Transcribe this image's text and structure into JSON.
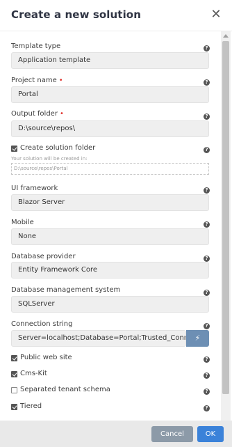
{
  "dialog": {
    "title": "Create a new solution",
    "close_glyph": "✕"
  },
  "help_glyph": "?",
  "template_type": {
    "label": "Template type",
    "value": "Application template"
  },
  "project_name": {
    "label": "Project name",
    "value": "Portal",
    "required_mark": "•"
  },
  "output_folder": {
    "label": "Output folder",
    "value": "D:\\source\\repos\\",
    "required_mark": "•"
  },
  "create_folder": {
    "label": "Create solution folder",
    "checked": true,
    "hint": "Your solution will be created in:",
    "path": "D:\\source\\repos\\Portal"
  },
  "ui_framework": {
    "label": "UI framework",
    "value": "Blazor Server"
  },
  "mobile": {
    "label": "Mobile",
    "value": "None"
  },
  "database_provider": {
    "label": "Database provider",
    "value": "Entity Framework Core"
  },
  "dbms": {
    "label": "Database management system",
    "value": "SQLServer"
  },
  "connection_string": {
    "label": "Connection string",
    "value": "Server=localhost;Database=Portal;Trusted_Conne",
    "button_glyph": "⚡"
  },
  "options": [
    {
      "label": "Public web site",
      "checked": true
    },
    {
      "label": "Cms-Kit",
      "checked": true
    },
    {
      "label": "Separated tenant schema",
      "checked": false
    },
    {
      "label": "Tiered",
      "checked": true
    }
  ],
  "footer": {
    "cancel_label": "Cancel",
    "ok_label": "OK"
  },
  "colors": {
    "ok": "#3b82d9",
    "cancel": "#8c9aa8",
    "connection_button": "#6d8fb4",
    "required": "#e0332e"
  }
}
